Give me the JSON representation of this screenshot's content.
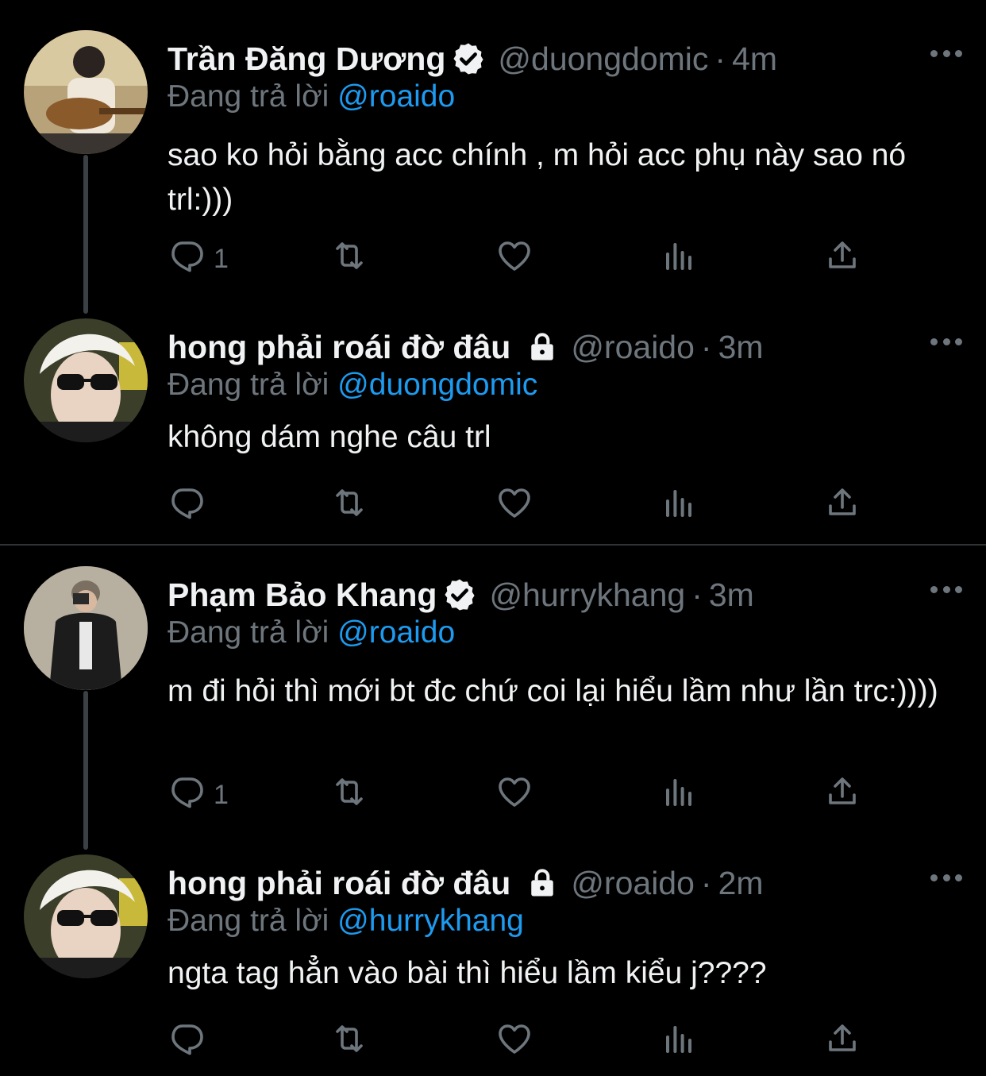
{
  "tweets": [
    {
      "name": "Trần Đăng Dương",
      "badge": "verified",
      "handle": "@duongdomic",
      "dot": "·",
      "time": "4m",
      "reply_prefix": "Đang trả lời",
      "reply_to": "@roaido",
      "text": "sao ko hỏi bằng acc chính , m hỏi acc phụ này sao nó trl:)))",
      "reply_count": "1"
    },
    {
      "name": "hong phải roái đờ đâu",
      "badge": "lock",
      "handle": "@roaido",
      "dot": "·",
      "time": "3m",
      "reply_prefix": "Đang trả lời",
      "reply_to": "@duongdomic",
      "text": "không dám nghe câu trl",
      "reply_count": ""
    },
    {
      "name": "Phạm Bảo Khang",
      "badge": "verified",
      "handle": "@hurrykhang",
      "dot": "·",
      "time": "3m",
      "reply_prefix": "Đang trả lời",
      "reply_to": "@roaido",
      "text": "m đi hỏi thì mới bt đc chứ coi lại hiểu lầm như lần trc:))))",
      "reply_count": "1"
    },
    {
      "name": "hong phải roái đờ đâu",
      "badge": "lock",
      "handle": "@roaido",
      "dot": "·",
      "time": "2m",
      "reply_prefix": "Đang trả lời",
      "reply_to": "@hurrykhang",
      "text": "ngta tag hẳn vào bài thì hiểu lầm kiểu j????",
      "reply_count": ""
    }
  ],
  "icons": {
    "reply": "reply-icon",
    "retweet": "retweet-icon",
    "like": "like-icon",
    "views": "views-icon",
    "share": "share-icon",
    "more": "more-icon",
    "verified": "verified-badge-icon",
    "lock": "lock-icon"
  },
  "colors": {
    "background": "#000000",
    "text": "#e7e9ea",
    "muted": "#6e767d",
    "link": "#1d9bf0",
    "thread_line": "#3b4045"
  }
}
